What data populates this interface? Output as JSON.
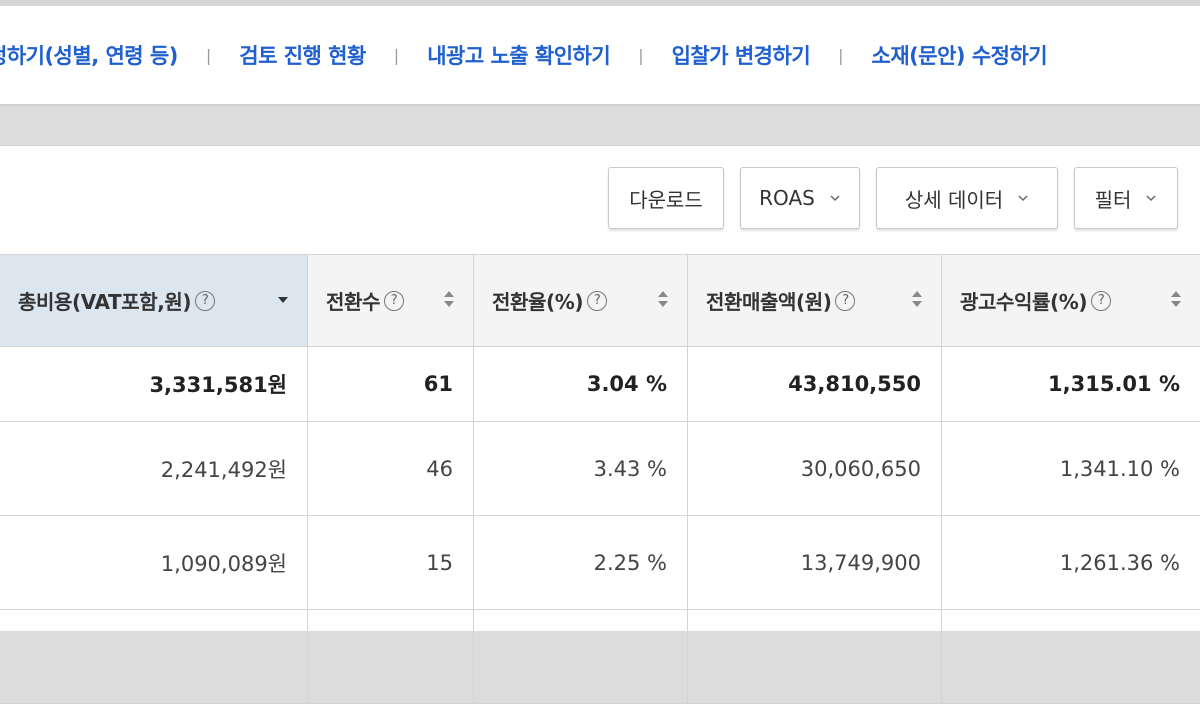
{
  "top_nav": {
    "links": [
      "정하기(성별, 연령 등)",
      "검토 진행 현황",
      "내광고 노출 확인하기",
      "입찰가 변경하기",
      "소재(문안) 수정하기"
    ],
    "separator": "|"
  },
  "toolbar": {
    "download_label": "다운로드",
    "roas_label": "ROAS",
    "detail_label": "상세 데이터",
    "filter_label": "필터"
  },
  "table": {
    "headers": [
      "총비용(VAT포함,원)",
      "전환수",
      "전환율(%)",
      "전환매출액(원)",
      "광고수익률(%)"
    ],
    "rows": [
      [
        "3,331,581원",
        "61",
        "3.04 %",
        "43,810,550",
        "1,315.01 %"
      ],
      [
        "2,241,492원",
        "46",
        "3.43 %",
        "30,060,650",
        "1,341.10 %"
      ],
      [
        "1,090,089원",
        "15",
        "2.25 %",
        "13,749,900",
        "1,261.36 %"
      ]
    ]
  },
  "colors": {
    "link": "#1f5fcf",
    "sorted_header_bg": "#dce6ee",
    "header_bg": "#f4f4f4"
  }
}
